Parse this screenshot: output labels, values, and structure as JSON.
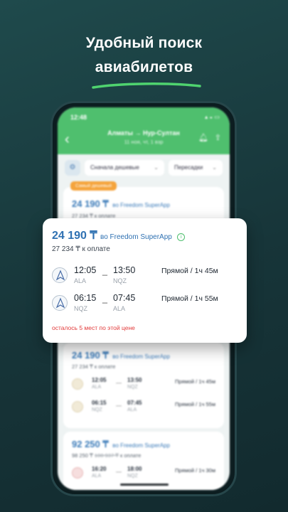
{
  "headline": {
    "line1": "Удобный поиск",
    "line2": "авиабилетов"
  },
  "colors": {
    "accent_green": "#4fbf6e",
    "price_blue": "#2f71b2",
    "warning_red": "#e23a3a",
    "badge_orange": "#f5a43c"
  },
  "phone": {
    "status_time": "12:48",
    "route": "Алматы → Нур-Султан",
    "route_details": "11 ноя, чт, 1 взр",
    "icons": {
      "back": "back-arrow-icon",
      "bell": "bell-icon",
      "share": "share-icon",
      "filter": "filter-icon"
    },
    "sort_chip": "Сначала дешевые",
    "transfers_chip": "Пересадки",
    "badge": "Самый дешевый",
    "card1": {
      "price": "24 190 ₸",
      "via": "во Freedom SuperApp",
      "sub": "27 234 ₸ к оплате"
    },
    "card2": {
      "price": "24 190 ₸",
      "via": "во Freedom SuperApp",
      "sub": "27 234 ₸ к оплате",
      "segments": [
        {
          "dep": "12:05",
          "dep_code": "ALA",
          "arr": "13:50",
          "arr_code": "NQZ",
          "duration": "Прямой / 1ч 45м"
        },
        {
          "dep": "06:15",
          "dep_code": "NQZ",
          "arr": "07:45",
          "arr_code": "ALA",
          "duration": "Прямой / 1ч 55м"
        }
      ]
    },
    "card3": {
      "price": "92 250 ₸",
      "via": "во Freedom SuperApp",
      "sub_price": "98 250 ₸",
      "sub_old": "108 937 ₸",
      "sub_label": "к оплате",
      "segment": {
        "dep": "16:20",
        "dep_code": "ALA",
        "arr": "18:00",
        "arr_code": "NQZ",
        "duration": "Прямой / 1ч 30м"
      }
    }
  },
  "overlay": {
    "price": "24 190 ₸",
    "via": "во Freedom SuperApp",
    "sub": "27 234 ₸ к оплате",
    "segments": [
      {
        "dep": "12:05",
        "dep_code": "ALA",
        "arr": "13:50",
        "arr_code": "NQZ",
        "duration": "Прямой / 1ч 45м"
      },
      {
        "dep": "06:15",
        "dep_code": "NQZ",
        "arr": "07:45",
        "arr_code": "ALA",
        "duration": "Прямой / 1ч 55м"
      }
    ],
    "warning": "осталось 5 мест по этой цене"
  }
}
